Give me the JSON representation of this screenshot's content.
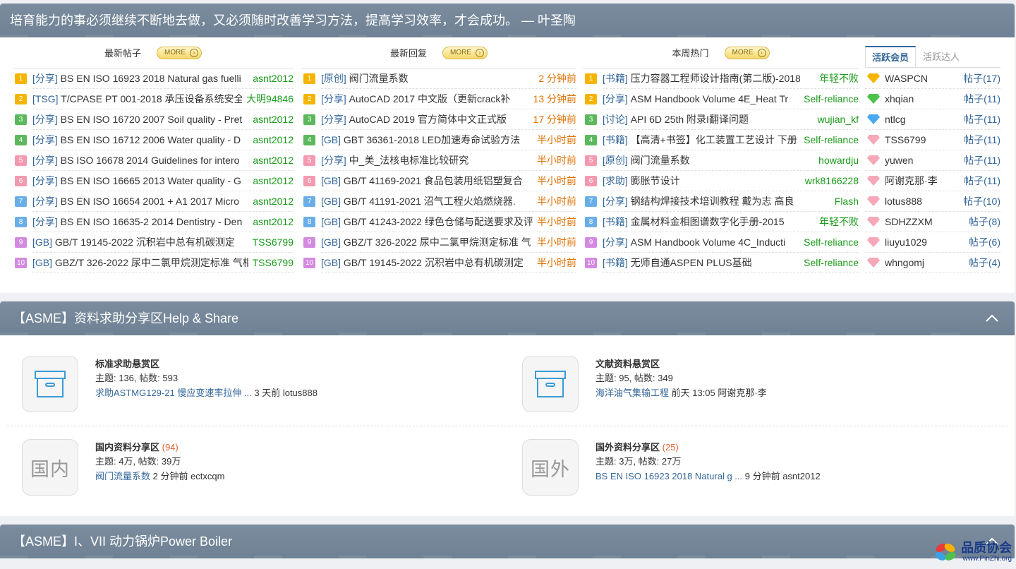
{
  "quote": "培育能力的事必须继续不断地去做，又必须随时改善学习方法，提高学习效率，才会成功。 — 叶圣陶",
  "more_label": "MORE",
  "colors": {
    "n1": "#f5b400",
    "n2": "#f5b400",
    "n3": "#5cb85c",
    "n4": "#5cb85c",
    "n5": "#f39ab0",
    "n6": "#f39ab0",
    "n7": "#6aaee8",
    "n8": "#6aaee8",
    "n9": "#d38ae0",
    "n10": "#d38ae0"
  },
  "latest_posts": {
    "title": "最新帖子",
    "rows": [
      {
        "n": "1",
        "tag": "[分享]",
        "text": "BS EN ISO 16923 2018 Natural gas fuelli",
        "right": "asnt2012"
      },
      {
        "n": "2",
        "tag": "[TSG]",
        "text": "T/CPASE PT 001-2018 承压设备系统安全",
        "right": "大明94846"
      },
      {
        "n": "3",
        "tag": "[分享]",
        "text": "BS EN ISO 16720 2007 Soil quality - Pret",
        "right": "asnt2012"
      },
      {
        "n": "4",
        "tag": "[分享]",
        "text": "BS EN ISO 16712 2006 Water quality - D",
        "right": "asnt2012"
      },
      {
        "n": "5",
        "tag": "[分享]",
        "text": "BS ISO 16678 2014 Guidelines for intero",
        "right": "asnt2012"
      },
      {
        "n": "6",
        "tag": "[分享]",
        "text": "BS EN ISO 16665 2013 Water quality - G",
        "right": "asnt2012"
      },
      {
        "n": "7",
        "tag": "[分享]",
        "text": "BS EN ISO 16654 2001 + A1 2017 Micro",
        "right": "asnt2012"
      },
      {
        "n": "8",
        "tag": "[分享]",
        "text": "BS EN ISO 16635-2 2014 Dentistry - Den",
        "right": "asnt2012"
      },
      {
        "n": "9",
        "tag": "[GB]",
        "text": "GB/T 19145-2022 沉积岩中总有机碳测定",
        "right": "TSS6799"
      },
      {
        "n": "10",
        "tag": "[GB]",
        "text": "GBZ/T 326-2022 尿中二氯甲烷测定标准 气相",
        "right": "TSS6799"
      }
    ]
  },
  "latest_replies": {
    "title": "最新回复",
    "rows": [
      {
        "n": "1",
        "tag": "[原创]",
        "text": "阀门流量系数",
        "right": "2 分钟前"
      },
      {
        "n": "2",
        "tag": "[分享]",
        "text": "AutoCAD 2017 中文版（更新crack补",
        "right": "13 分钟前"
      },
      {
        "n": "3",
        "tag": "[分享]",
        "text": "AutoCAD 2019 官方简体中文正式版",
        "right": "17 分钟前"
      },
      {
        "n": "4",
        "tag": "[GB]",
        "text": "GBT 36361-2018 LED加速寿命试验方法",
        "right": "半小时前"
      },
      {
        "n": "5",
        "tag": "[分享]",
        "text": "中_美_法核电标准比较研究",
        "right": "半小时前"
      },
      {
        "n": "6",
        "tag": "[GB]",
        "text": "GB/T 41169-2021 食品包装用纸铝塑复合",
        "right": "半小时前"
      },
      {
        "n": "7",
        "tag": "[GB]",
        "text": "GB/T 41191-2021 沼气工程火焰燃烧器.",
        "right": "半小时前"
      },
      {
        "n": "8",
        "tag": "[GB]",
        "text": "GB/T 41243-2022 绿色仓储与配送要求及评",
        "right": "半小时前"
      },
      {
        "n": "9",
        "tag": "[GB]",
        "text": "GBZ/T 326-2022 尿中二氯甲烷测定标准 气",
        "right": "半小时前"
      },
      {
        "n": "10",
        "tag": "[GB]",
        "text": "GB/T 19145-2022 沉积岩中总有机碳测定",
        "right": "半小时前"
      }
    ]
  },
  "weekly_hot": {
    "title": "本周热门",
    "rows": [
      {
        "n": "1",
        "tag": "[书籍]",
        "text": "压力容器工程师设计指南(第二版)-2018",
        "right": "年轻不败"
      },
      {
        "n": "2",
        "tag": "[分享]",
        "text": "ASM Handbook Volume 4E_Heat Tr",
        "right": "Self-reliance"
      },
      {
        "n": "3",
        "tag": "[讨论]",
        "text": "API 6D 25th 附录I翻译问题",
        "right": "wujian_kf"
      },
      {
        "n": "4",
        "tag": "[书籍]",
        "text": "【高清+书签】化工装置工艺设计 下册",
        "right": "Self-reliance"
      },
      {
        "n": "5",
        "tag": "[原创]",
        "text": "阀门流量系数",
        "right": "howardju"
      },
      {
        "n": "6",
        "tag": "[求助]",
        "text": "膨胀节设计",
        "right": "wrk8166228"
      },
      {
        "n": "7",
        "tag": "[分享]",
        "text": "钢结构焊接技术培训教程 戴为志 高良",
        "right": "Flash"
      },
      {
        "n": "8",
        "tag": "[书籍]",
        "text": "金属材料金相图谱数字化手册-2015",
        "right": "年轻不败"
      },
      {
        "n": "9",
        "tag": "[分享]",
        "text": "ASM Handbook Volume 4C_Inducti",
        "right": "Self-reliance"
      },
      {
        "n": "10",
        "tag": "[书籍]",
        "text": "无师自通ASPEN PLUS基础",
        "right": "Self-reliance"
      }
    ]
  },
  "members": {
    "tab_active": "活跃会员",
    "tab_other": "活跃达人",
    "rows": [
      {
        "name": "WASPCN",
        "count": "帖子(17)",
        "gem": "#f5b400"
      },
      {
        "name": "xhqian",
        "count": "帖子(11)",
        "gem": "#4cc24c"
      },
      {
        "name": "ntlcg",
        "count": "帖子(11)",
        "gem": "#4aa8f0"
      },
      {
        "name": "TSS6799",
        "count": "帖子(11)",
        "gem": "#f7a8b8"
      },
      {
        "name": "yuwen",
        "count": "帖子(11)",
        "gem": "#f7a8b8"
      },
      {
        "name": "阿谢克那·李",
        "count": "帖子(11)",
        "gem": "#f7a8b8"
      },
      {
        "name": "lotus888",
        "count": "帖子(10)",
        "gem": "#f7a8b8"
      },
      {
        "name": "SDHZZXM",
        "count": "帖子(8)",
        "gem": "#f7a8b8"
      },
      {
        "name": "liuyu1029",
        "count": "帖子(6)",
        "gem": "#f7a8b8"
      },
      {
        "name": "whngomj",
        "count": "帖子(4)",
        "gem": "#f7a8b8"
      }
    ]
  },
  "help_section": {
    "title": "【ASME】资料求助分享区Help & Share",
    "forums": [
      {
        "name": "标准求助悬赏区",
        "new": "",
        "stat": "主题: 136, 帖数: 593",
        "link": "求助ASTMG129-21 慢应变速率拉伸 ...",
        "after": " 3 天前 lotus888"
      },
      {
        "name": "文献资料悬赏区",
        "new": "",
        "stat": "主题: 95, 帖数: 349",
        "link": "海洋油气集输工程",
        "after": " 前天 13:05 阿谢克那·李"
      },
      {
        "name": "国内资料分享区",
        "new": "(94)",
        "stat": "主题: 4万, 帖数: 39万",
        "link": "阀门流量系数",
        "after": " 2 分钟前 ectxcqm",
        "icon_text": "国内"
      },
      {
        "name": "国外资料分享区",
        "new": "(25)",
        "stat": "主题: 3万, 帖数: 27万",
        "link": "BS EN ISO 16923 2018 Natural g ...",
        "after": " 9 分钟前 asnt2012",
        "icon_text": "国外"
      }
    ]
  },
  "boiler_section": {
    "title": "【ASME】I、VII 动力锅炉Power Boiler"
  },
  "watermark": {
    "name": "品质协会",
    "url": "www.PinZhi.org"
  }
}
